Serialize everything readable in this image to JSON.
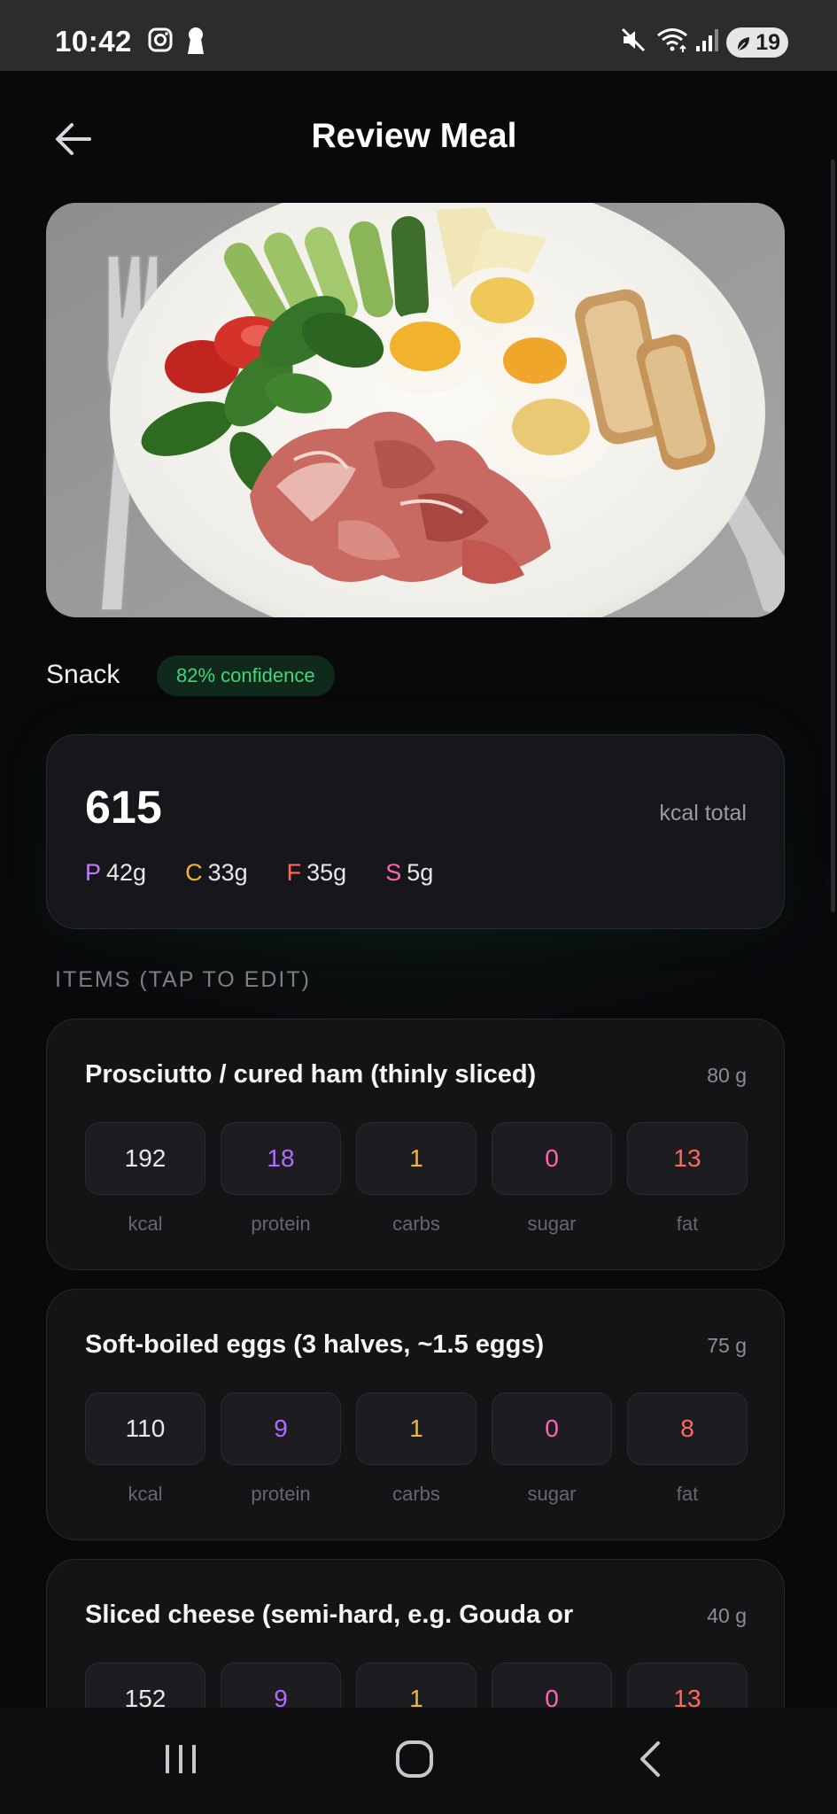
{
  "status": {
    "time": "10:42",
    "battery": "19",
    "icons": [
      "instagram-icon",
      "keyhole-icon",
      "mute-icon",
      "wifi-icon",
      "signal-icon",
      "battery-saver-icon"
    ]
  },
  "header": {
    "title": "Review Meal",
    "back_icon": "arrow-left-icon"
  },
  "meal": {
    "type": "Snack",
    "confidence": "82% confidence"
  },
  "totals": {
    "kcal": "615",
    "unit": "kcal total",
    "macros": [
      {
        "letter": "P",
        "value": "42g",
        "color": "#c07cff"
      },
      {
        "letter": "C",
        "value": "33g",
        "color": "#f5b62f"
      },
      {
        "letter": "F",
        "value": "35g",
        "color": "#ff6a5a"
      },
      {
        "letter": "S",
        "value": "5g",
        "color": "#ff64b4"
      }
    ]
  },
  "items_label": "ITEMS (TAP TO EDIT)",
  "nutrient_labels": [
    "kcal",
    "protein",
    "carbs",
    "sugar",
    "fat"
  ],
  "nutrient_colors": {
    "kcal": "#e8e8ea",
    "protein": "#b06cff",
    "carbs": "#f5b62f",
    "sugar": "#ff64b4",
    "fat": "#ff6a5a"
  },
  "items": [
    {
      "name": "Prosciutto / cured ham (thinly sliced)",
      "weight": "80 g",
      "values": [
        "192",
        "18",
        "1",
        "0",
        "13"
      ]
    },
    {
      "name": "Soft-boiled eggs (3 halves, ~1.5 eggs)",
      "weight": "75 g",
      "values": [
        "110",
        "9",
        "1",
        "0",
        "8"
      ]
    },
    {
      "name": "Sliced cheese (semi-hard, e.g. Gouda or",
      "weight": "40 g",
      "values": [
        "152",
        "9",
        "1",
        "0",
        "13"
      ]
    }
  ],
  "nav": {
    "recents_icon": "recents-icon",
    "home_icon": "home-icon",
    "back_icon": "nav-back-icon"
  }
}
